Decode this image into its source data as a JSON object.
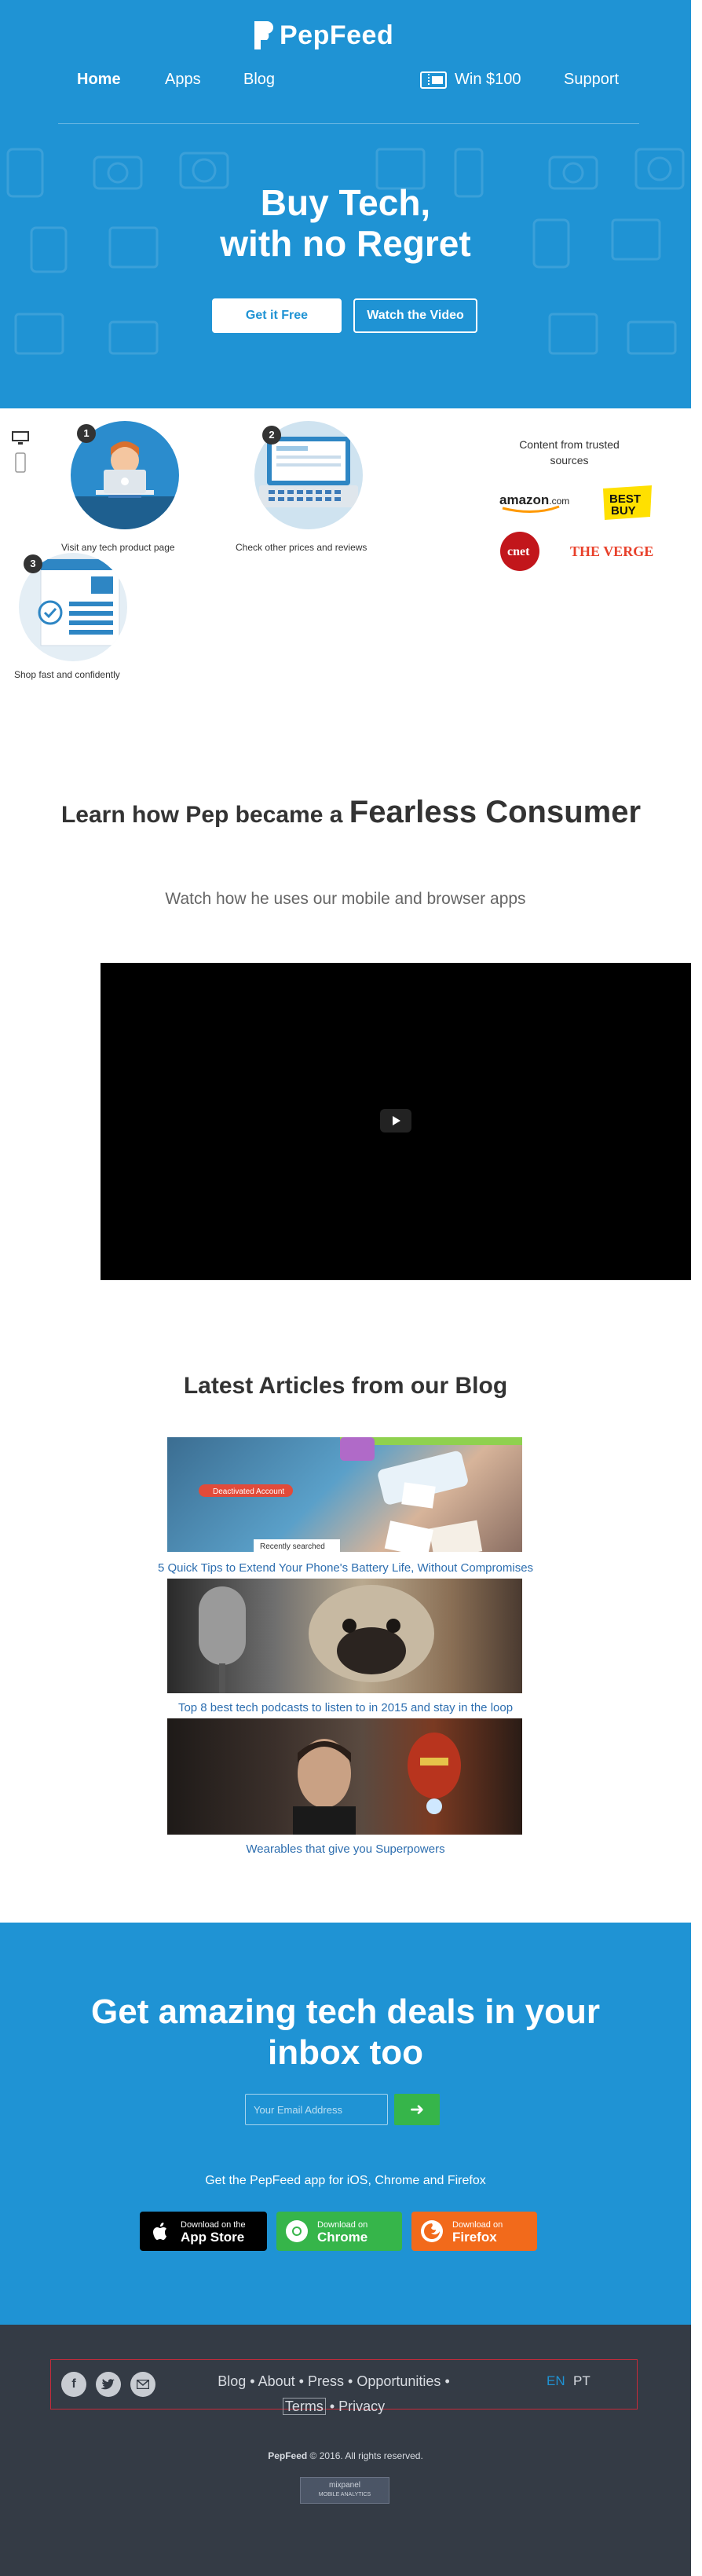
{
  "brand": {
    "name": "PepFeed",
    "primary_color": "#1f93d4",
    "accent_green": "#36b54a"
  },
  "nav": {
    "home": "Home",
    "apps": "Apps",
    "blog": "Blog",
    "win": "Win $100",
    "win_icon": "ticket-icon",
    "support": "Support"
  },
  "hero": {
    "title_line1": "Buy Tech,",
    "title_line2": "with no Regret",
    "cta_primary": "Get it Free",
    "cta_secondary": "Watch the Video"
  },
  "steps": [
    {
      "number": "1",
      "caption": "Visit any tech product page",
      "icon": "person-at-laptop-icon"
    },
    {
      "number": "2",
      "caption": "Check other prices and reviews",
      "icon": "laptop-browser-icon"
    },
    {
      "number": "3",
      "caption": "Shop fast and confidently",
      "icon": "shopping-page-icon"
    }
  ],
  "device_icons": [
    "desktop-icon",
    "mobile-icon"
  ],
  "sources": {
    "title": "Content from trusted sources",
    "logos": [
      "amazon.com",
      "BEST BUY",
      "cnet",
      "THE VERGE"
    ]
  },
  "learn": {
    "prefix": "Learn how Pep became a",
    "highlight": "Fearless Consumer",
    "subtitle": "Watch how he uses our mobile and browser apps"
  },
  "blog": {
    "title": "Latest Articles from our Blog",
    "articles": [
      {
        "title": "5 Quick Tips to Extend Your Phone's Battery Life, Without Compromises",
        "tag": "Deactivated Account",
        "caption": "Recently searched"
      },
      {
        "title": "Top 8 best tech podcasts to listen to in 2015 and stay in the loop"
      },
      {
        "title": "Wearables that give you Superpowers"
      }
    ]
  },
  "cta": {
    "title_line1": "Get amazing tech deals in your",
    "title_line2": "inbox too",
    "email_placeholder": "Your Email Address",
    "submit_icon": "arrow-right-icon",
    "apps_text": "Get the PepFeed app for iOS, Chrome and Firefox",
    "stores": [
      {
        "small": "Download on the",
        "big": "App Store",
        "color": "#000000",
        "icon": "apple-icon"
      },
      {
        "small": "Download on",
        "big": "Chrome",
        "color": "#36b54a",
        "icon": "chrome-icon"
      },
      {
        "small": "Download on",
        "big": "Firefox",
        "color": "#f26a1b",
        "icon": "firefox-icon"
      }
    ]
  },
  "footer": {
    "social": [
      "facebook-icon",
      "twitter-icon",
      "email-icon"
    ],
    "links": [
      "Blog",
      "About",
      "Press",
      "Opportunities",
      "Terms",
      "Privacy"
    ],
    "separator": "•",
    "lang_en": "EN",
    "lang_pt": "PT",
    "copyright_brand": "PepFeed",
    "copyright_rest": "© 2016. All rights reserved.",
    "badge_line1": "mixpanel",
    "badge_line2": "MOBILE ANALYTICS"
  }
}
